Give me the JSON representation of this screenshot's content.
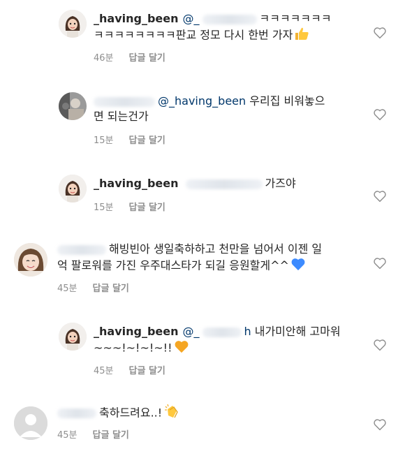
{
  "comments": [
    {
      "username": "_having_been",
      "mention": "@_",
      "line1_tail": "ㅋㅋㅋㅋㅋㅋㅋ",
      "line2": "ㅋㅋㅋㅋㅋㅋㅋㅋ판교 정모 다시 한번 가자",
      "emoji": "thumbs-up",
      "time": "46분",
      "reply": "답글 달기"
    },
    {
      "mention": "@_having_been",
      "line1_tail": "우리집 비워놓으",
      "line2": "면 되는건가",
      "time": "15분",
      "reply": "답글 달기"
    },
    {
      "username": "_having_been",
      "line1_tail": "가즈야",
      "time": "15분",
      "reply": "답글 달기"
    },
    {
      "line1_tail": "해빙빈아 생일축하하고 천만을 넘어서 이젠 일",
      "line2": "억 팔로워를 가진 우주대스타가 되길 응원할게^^",
      "emoji": "blue-heart",
      "time": "45분",
      "reply": "답글 달기"
    },
    {
      "username": "_having_been",
      "mention": "@_",
      "mention_tail": "h",
      "line1_tail": "내가미안해 고마워",
      "line2": "~~~!~!~!~!!",
      "emoji": "orange-heart",
      "time": "45분",
      "reply": "답글 달기"
    },
    {
      "line1_tail": "축하드려요..!",
      "emoji": "clapping-hands",
      "time": "45분",
      "reply": "답글 달기"
    }
  ],
  "colors": {
    "text": "#262626",
    "meta": "#8e8e8e",
    "mention": "#00376b",
    "heart_outline": "#8e8e8e",
    "blue_heart": "#3d8bff",
    "orange_heart": "#f5a623"
  }
}
